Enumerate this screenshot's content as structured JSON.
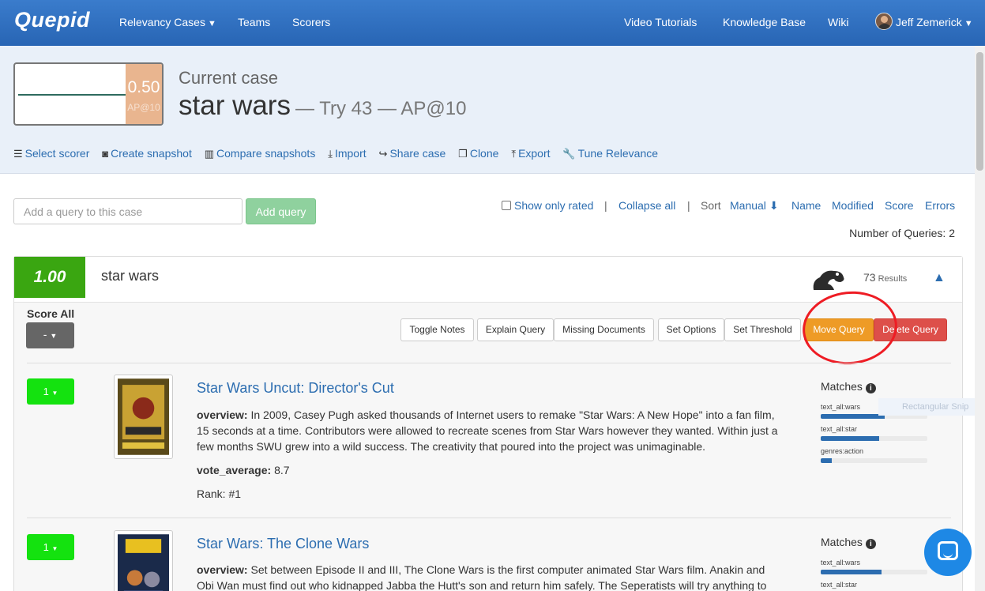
{
  "nav": {
    "brand": "Quepid",
    "relevancy_cases": "Relevancy Cases",
    "teams": "Teams",
    "scorers": "Scorers",
    "video_tutorials": "Video Tutorials",
    "knowledge_base": "Knowledge Base",
    "wiki": "Wiki",
    "user": "Jeff Zemerick"
  },
  "header": {
    "score": "0.50",
    "score_label": "AP@10",
    "current_case_label": "Current case",
    "case_name": "star wars",
    "case_sub": "— Try 43 — AP@10",
    "actions": [
      {
        "label": "Select scorer",
        "icon": "list-icon"
      },
      {
        "label": "Create snapshot",
        "icon": "camera-icon"
      },
      {
        "label": "Compare snapshots",
        "icon": "chart-icon"
      },
      {
        "label": "Import",
        "icon": "download-icon"
      },
      {
        "label": "Share case",
        "icon": "share-icon"
      },
      {
        "label": "Clone",
        "icon": "clone-icon"
      },
      {
        "label": "Export",
        "icon": "upload-icon"
      },
      {
        "label": "Tune Relevance",
        "icon": "wrench-icon"
      }
    ]
  },
  "query_controls": {
    "placeholder": "Add a query to this case",
    "add_button": "Add query",
    "show_only_rated": "Show only rated",
    "collapse_all": "Collapse all",
    "sort_label": "Sort",
    "sort_manual": "Manual",
    "sort_name": "Name",
    "sort_modified": "Modified",
    "sort_score": "Score",
    "sort_errors": "Errors",
    "separator": "|",
    "number_of_queries": "Number of Queries: 2"
  },
  "query": {
    "score": "1.00",
    "text": "star wars",
    "results_count": "73",
    "results_label": "Results",
    "score_all_label": "Score All",
    "score_all_value": "-",
    "toolbar": {
      "toggle_notes": "Toggle Notes",
      "explain_query": "Explain Query",
      "missing_documents": "Missing Documents",
      "set_options": "Set Options",
      "set_threshold": "Set Threshold",
      "move_query": "Move Query",
      "delete_query": "Delete Query"
    }
  },
  "documents": [
    {
      "rating": "1",
      "title": "Star Wars Uncut: Director's Cut",
      "overview_label": "overview:",
      "overview": "In 2009, Casey Pugh asked thousands of Internet users to remake \"Star Wars: A New Hope\" into a fan film, 15 seconds at a time. Contributors were allowed to recreate scenes from Star Wars however they wanted. Within just a few months SWU grew into a wild success. The creativity that poured into the project was unimaginable.",
      "vote_label": "vote_average:",
      "vote_average": "8.7",
      "rank": "Rank: #1",
      "matches_label": "Matches",
      "matches": [
        {
          "field": "text_all:wars",
          "value": 0.6
        },
        {
          "field": "text_all:star",
          "value": 0.55
        },
        {
          "field": "genres:action",
          "value": 0.1
        }
      ]
    },
    {
      "rating": "1",
      "title": "Star Wars: The Clone Wars",
      "overview_label": "overview:",
      "overview": "Set between Episode II and III, The Clone Wars is the first computer animated Star Wars film. Anakin and Obi Wan must find out who kidnapped Jabba the Hutt's son and return him safely. The Seperatists will try anything to",
      "matches_label": "Matches",
      "matches": [
        {
          "field": "text_all:wars",
          "value": 0.57
        },
        {
          "field": "text_all:star",
          "value": 0.52
        }
      ]
    }
  ],
  "overlay": {
    "snip_text": "Rectangular Snip"
  },
  "colors": {
    "navbar": "#2d6fbe",
    "query_score": "#3aa611",
    "rating": "#14e20f",
    "move_query": "#ee9b26",
    "delete_query": "#dd4f4a",
    "annotation": "#ee1c24"
  }
}
